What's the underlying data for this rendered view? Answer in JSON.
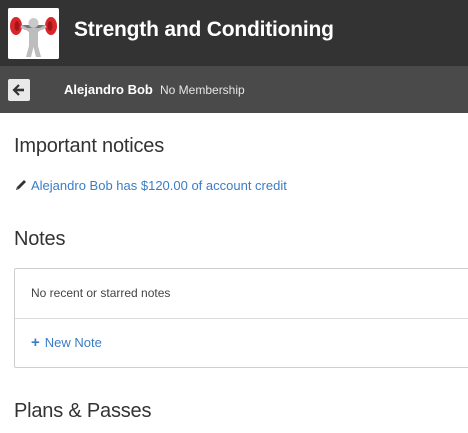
{
  "header": {
    "app_title": "Strength and Conditioning",
    "logo_icon": "weightlifter-logo-icon"
  },
  "member_bar": {
    "back_icon": "arrow-left-icon",
    "name": "Alejandro Bob",
    "membership_status": "No Membership"
  },
  "notices": {
    "heading": "Important notices",
    "items": [
      {
        "icon": "pencil-icon",
        "text": "Alejandro Bob has $120.00 of account credit"
      }
    ]
  },
  "notes": {
    "heading": "Notes",
    "empty_text": "No recent or starred notes",
    "new_note_icon": "plus-icon",
    "new_note_label": "New Note"
  },
  "plans": {
    "heading": "Plans & Passes"
  },
  "colors": {
    "topbar": "#333333",
    "subbar": "#4a4a4a",
    "link": "#3b7dc4"
  }
}
